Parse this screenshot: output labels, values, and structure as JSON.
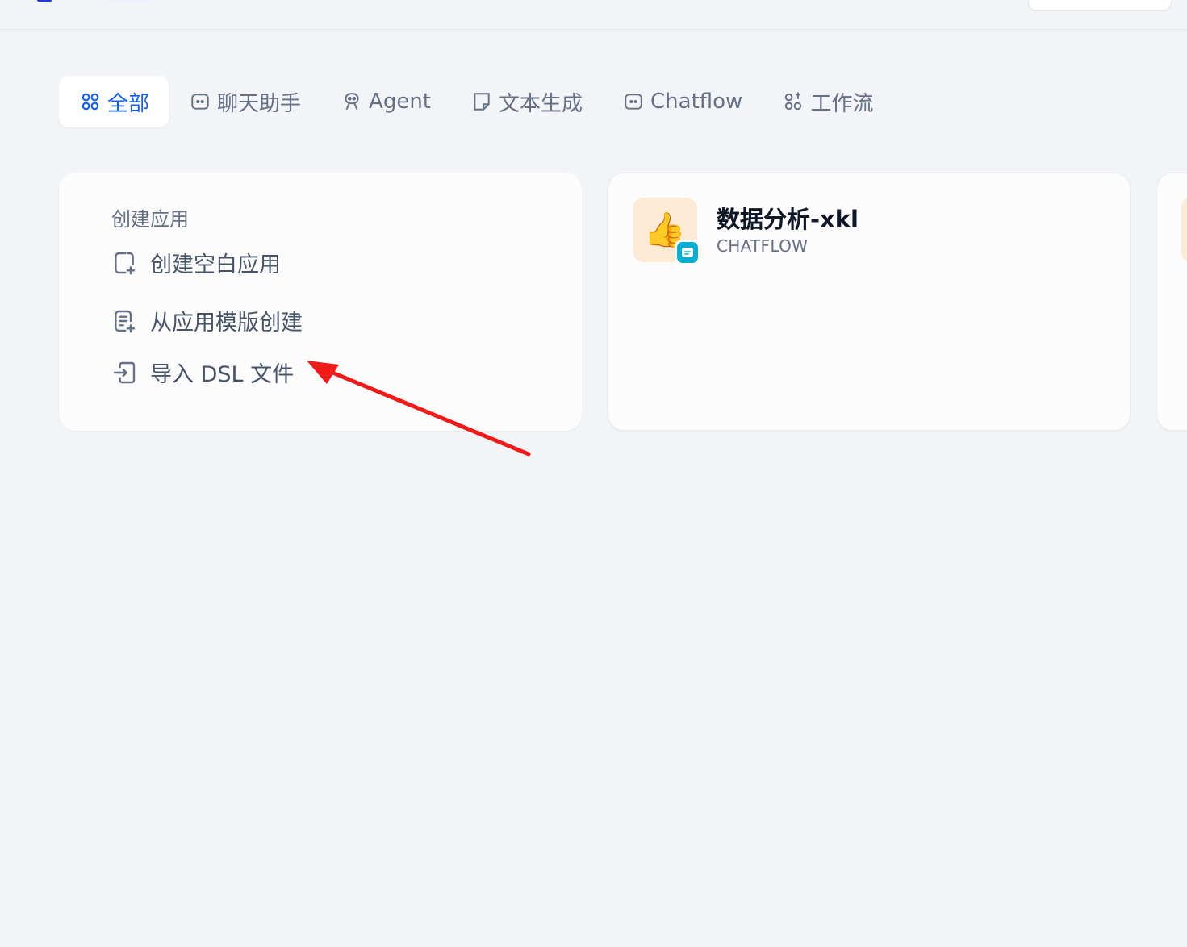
{
  "tabs": [
    {
      "label": "全部",
      "icon": "grid-icon",
      "active": true
    },
    {
      "label": "聊天助手",
      "icon": "chat-bubble-icon",
      "active": false
    },
    {
      "label": "Agent",
      "icon": "robot-icon",
      "active": false
    },
    {
      "label": "文本生成",
      "icon": "note-icon",
      "active": false
    },
    {
      "label": "Chatflow",
      "icon": "chat-bubble-icon",
      "active": false
    },
    {
      "label": "工作流",
      "icon": "workflow-icon",
      "active": false
    }
  ],
  "create_card": {
    "title": "创建应用",
    "items": [
      {
        "label": "创建空白应用",
        "icon": "file-plus-icon"
      },
      {
        "label": "从应用模版创建",
        "icon": "template-icon"
      },
      {
        "label": "导入 DSL 文件",
        "icon": "import-icon"
      }
    ]
  },
  "app_card": {
    "name": "数据分析-xkl",
    "type": "CHATFLOW",
    "icon_emoji": "👍",
    "icon_bg": "#ffead5",
    "badge_color": "#06aed4"
  },
  "colors": {
    "accent": "#155eef",
    "background": "#f2f4f7",
    "annotation_arrow": "#ef1a1a"
  }
}
